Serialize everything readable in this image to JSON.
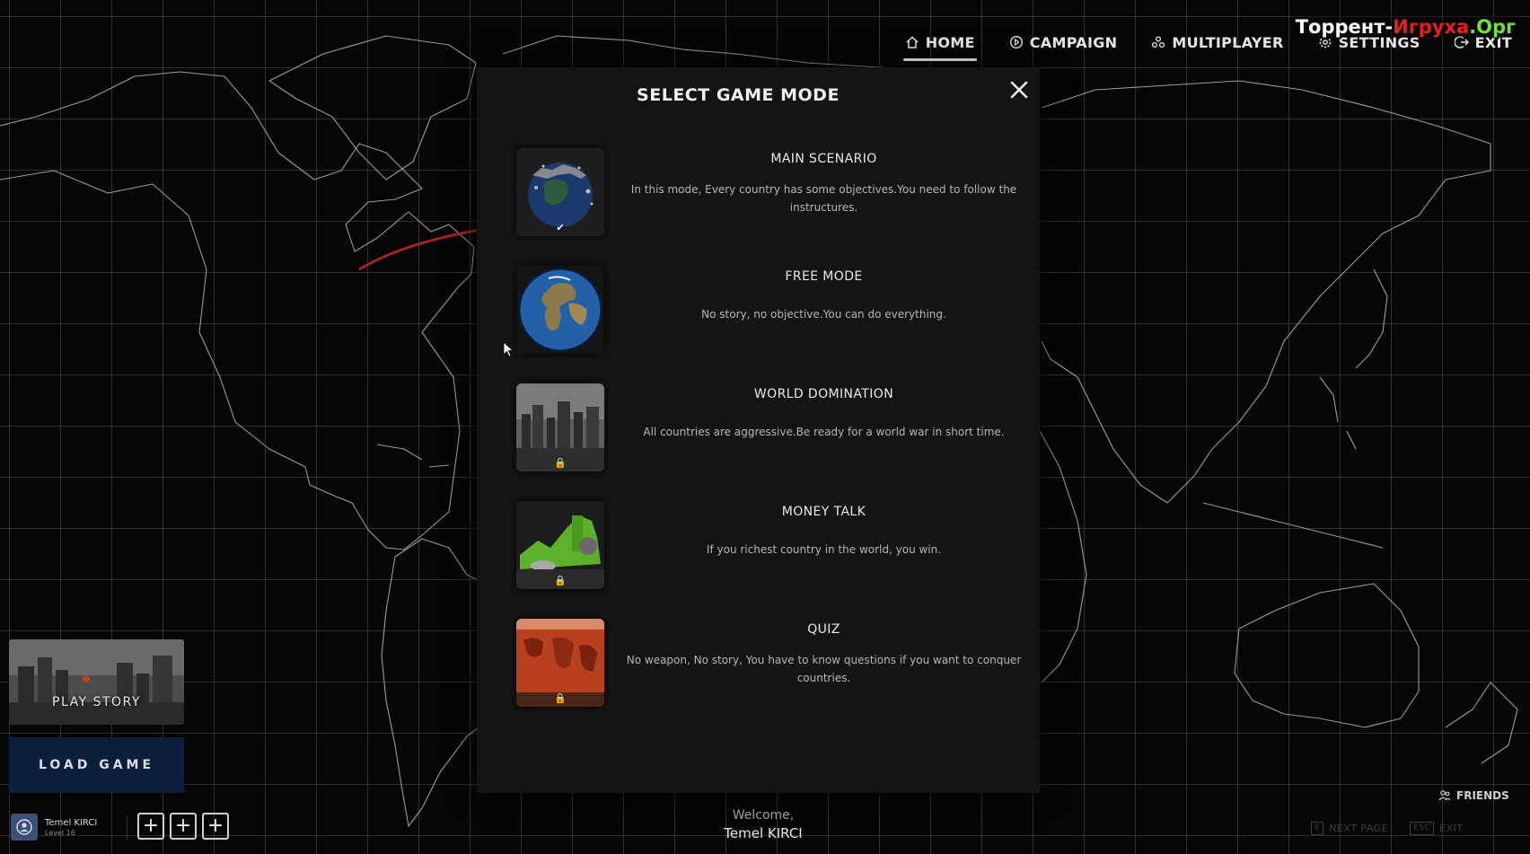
{
  "nav": {
    "items": [
      {
        "label": "HOME",
        "icon": "home-icon",
        "active": true
      },
      {
        "label": "CAMPAIGN",
        "icon": "campaign-icon",
        "active": false
      },
      {
        "label": "MULTIPLAYER",
        "icon": "multiplayer-icon",
        "active": false
      },
      {
        "label": "SETTINGS",
        "icon": "gear-icon",
        "active": false
      },
      {
        "label": "EXIT",
        "icon": "exit-icon",
        "active": false
      }
    ]
  },
  "watermark": {
    "part1": "Торрент-",
    "part2": "Игруха",
    "part3": ".Орг"
  },
  "modal": {
    "title": "SELECT GAME MODE",
    "modes": [
      {
        "name": "MAIN SCENARIO",
        "description": "In this mode, Every country has some objectives.You need to follow the instructures.",
        "status": "selected",
        "thumb": "earth-debris"
      },
      {
        "name": "FREE MODE",
        "description": "No story, no objective.You can do everything.",
        "status": "available",
        "thumb": "earth"
      },
      {
        "name": "WORLD DOMINATION",
        "description": "All countries are aggressive.Be ready for a world war in short time.",
        "status": "locked",
        "thumb": "ruined-city"
      },
      {
        "name": "MONEY TALK",
        "description": "If you richest country in the world, you win.",
        "status": "locked",
        "thumb": "money-chart"
      },
      {
        "name": "QUIZ",
        "description": "No weapon, No story, You have to know questions if you want to conquer countries.",
        "status": "locked",
        "thumb": "world-map-orange"
      }
    ]
  },
  "left_panel": {
    "play_story": "PLAY STORY",
    "load_game": "LOAD GAME"
  },
  "profile": {
    "name": "Temel KIRCI",
    "level": "Level 16"
  },
  "welcome": {
    "line1": "Welcome,",
    "line2": "Temel KIRCI"
  },
  "friends": "FRIENDS",
  "hints": [
    {
      "key": "E",
      "label": "NEXT PAGE"
    },
    {
      "key": "ESC",
      "label": "EXIT"
    }
  ],
  "colors": {
    "background": "#050505",
    "modal_bg": "#141414",
    "load_game_bg": "#0c1f3a",
    "nav_active": "#ffffff"
  }
}
